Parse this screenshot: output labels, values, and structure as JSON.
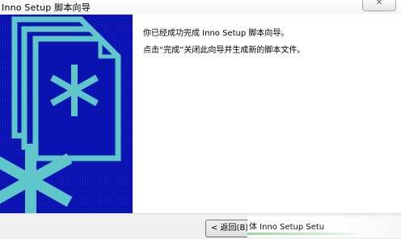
{
  "window": {
    "title": "Inno Setup 脚本向导"
  },
  "titlebar": {
    "close_icon": "close-icon",
    "close_glyph": "✕"
  },
  "sidebar": {
    "graphic_icon": "document-asterisk-icon",
    "colors": {
      "background": "#0a12b0",
      "accent": "#5fc7c9"
    }
  },
  "content": {
    "line1": "你已经成功完成 Inno Setup 脚本向导。",
    "line2": "点击“完成”关闭此向导并生成新的脚本文件。"
  },
  "footer": {
    "back_label": "< 返回(B)",
    "tooltip_text": "体 Inno Setup Setu"
  }
}
